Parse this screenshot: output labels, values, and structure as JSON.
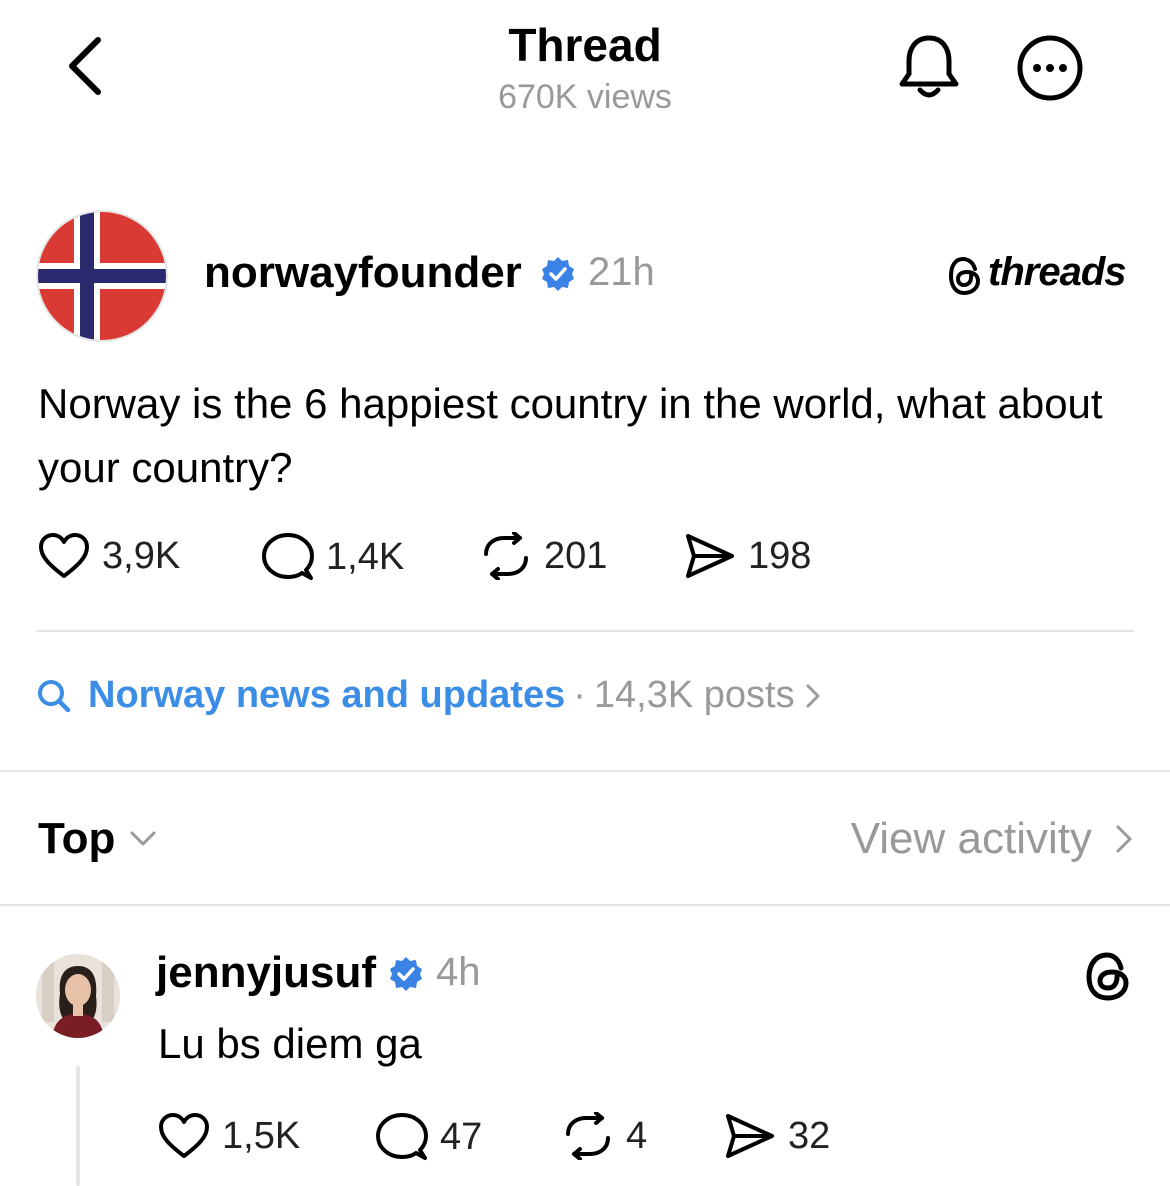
{
  "header": {
    "title": "Thread",
    "views": "670K views",
    "icons": [
      "back-chevron-icon",
      "bell-icon",
      "more-dots-icon"
    ]
  },
  "post": {
    "username": "norwayfounder",
    "verified": true,
    "time": "21h",
    "brand": "threads",
    "avatar": "norway-flag",
    "text": "Norway is the 6 happiest country in the world, what about your country?",
    "likes": "3,9K",
    "replies": "1,4K",
    "reposts": "201",
    "shares": "198"
  },
  "topic": {
    "name": "Norway news and updates",
    "separator": "·",
    "count": "14,3K posts"
  },
  "sort": {
    "label": "Top",
    "view_activity": "View activity"
  },
  "reply": {
    "username": "jennyjusuf",
    "verified": true,
    "time": "4h",
    "text": "Lu bs diem ga",
    "likes": "1,5K",
    "replies": "47",
    "reposts": "4",
    "shares": "32"
  },
  "colors": {
    "verified_blue": "#3b82e6",
    "topic_blue": "#3b8de6",
    "muted_gray": "#999999",
    "divider": "#e4e4e4",
    "flag_red": "#d93a34",
    "flag_blue": "#2c2a6e"
  }
}
